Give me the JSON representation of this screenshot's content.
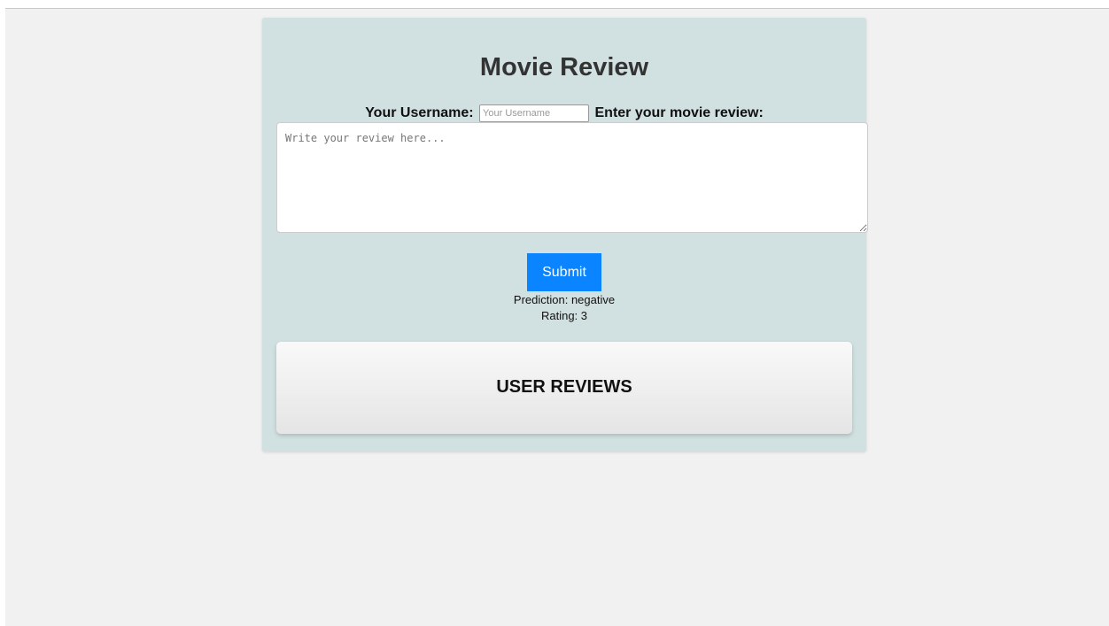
{
  "page": {
    "title": "Movie Review"
  },
  "form": {
    "username_label": "Your Username:",
    "username_placeholder": "Your Username",
    "username_value": "",
    "review_label": "Enter your movie review:",
    "review_placeholder": "Write your review here...",
    "review_value": "",
    "submit_label": "Submit"
  },
  "result": {
    "prediction_text": "Prediction: negative",
    "rating_text": "Rating: 3"
  },
  "reviews": {
    "heading": "USER REVIEWS"
  },
  "colors": {
    "page_background": "#f1f1f1",
    "card_background": "#d1e0e0",
    "submit_button": "#0a84ff"
  }
}
